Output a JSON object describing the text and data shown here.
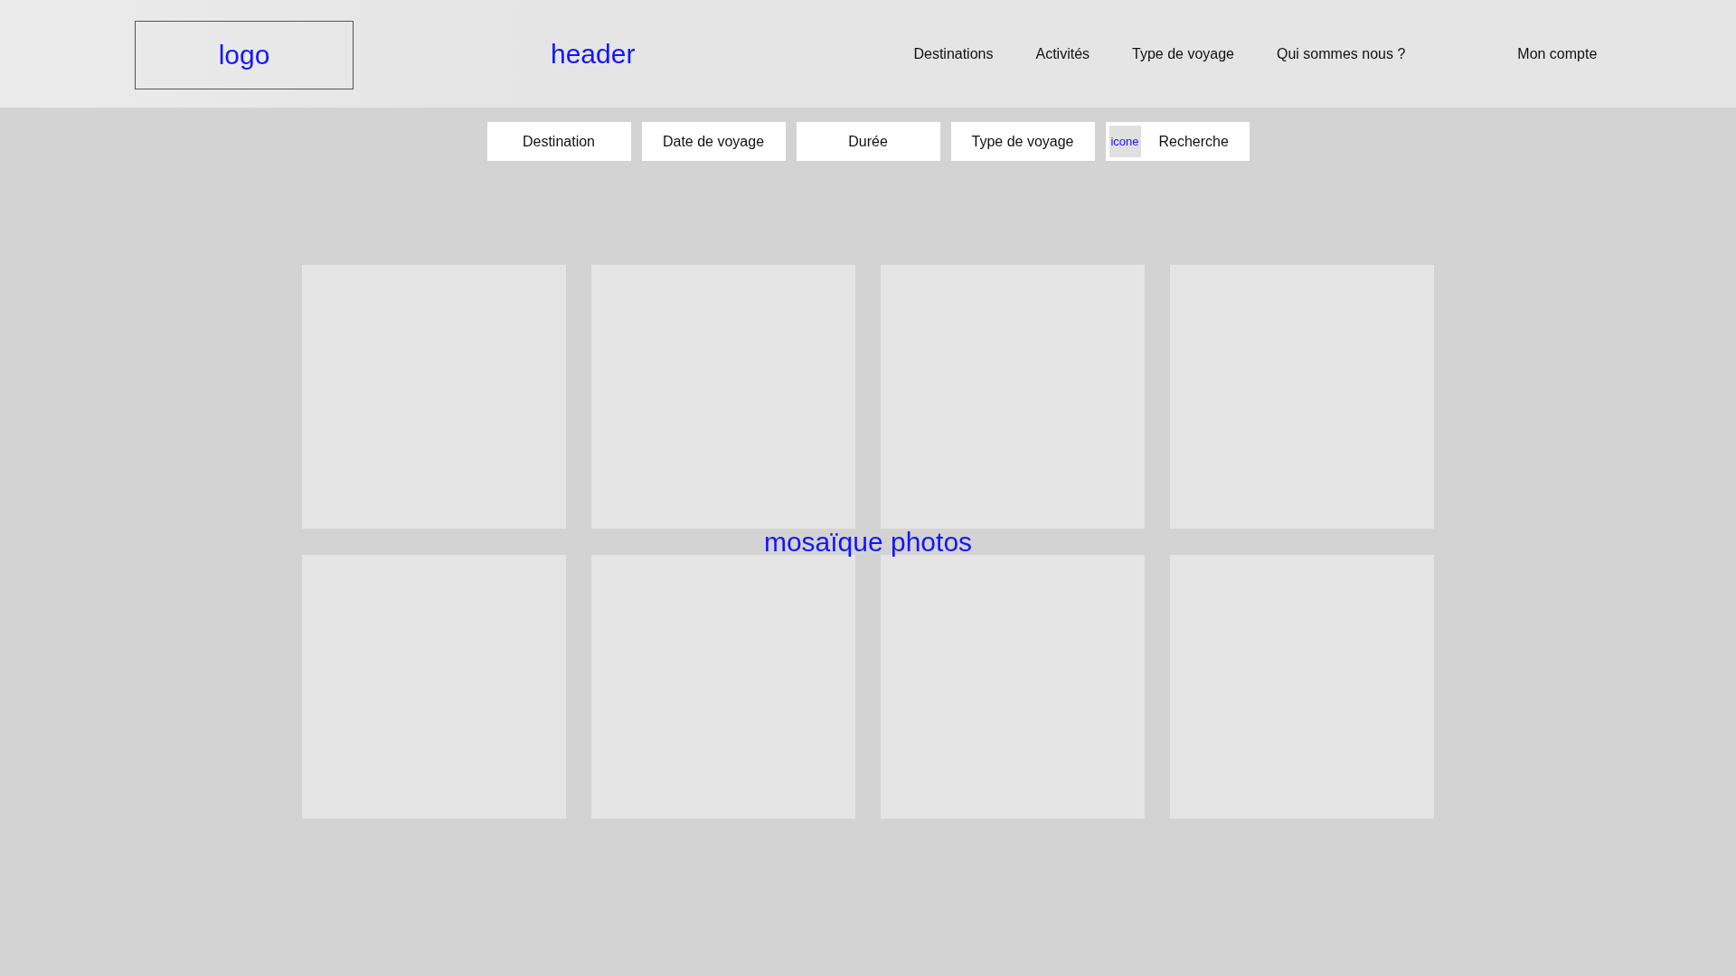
{
  "header": {
    "logo": "logo",
    "title": "header",
    "nav": [
      {
        "label": "Destinations"
      },
      {
        "label": "Activités"
      },
      {
        "label": "Type de voyage"
      },
      {
        "label": "Qui sommes nous ?"
      }
    ],
    "account": "Mon compte"
  },
  "search_bar": {
    "fields": [
      {
        "kind": "filter",
        "label": "Destination"
      },
      {
        "kind": "filter",
        "label": "Date de voyage"
      },
      {
        "kind": "filter",
        "label": "Durée"
      },
      {
        "kind": "filter",
        "label": "Type de voyage"
      },
      {
        "kind": "search",
        "icon": "icone",
        "label": "Recherche"
      }
    ]
  },
  "mosaic": {
    "label": "mosaïque photos",
    "tiles": [
      {
        "kind": "placeholder"
      },
      {
        "kind": "placeholder"
      },
      {
        "kind": "placeholder"
      },
      {
        "kind": "placeholder"
      },
      {
        "kind": "placeholder"
      },
      {
        "kind": "placeholder"
      },
      {
        "kind": "placeholder"
      },
      {
        "kind": "placeholder"
      }
    ]
  }
}
